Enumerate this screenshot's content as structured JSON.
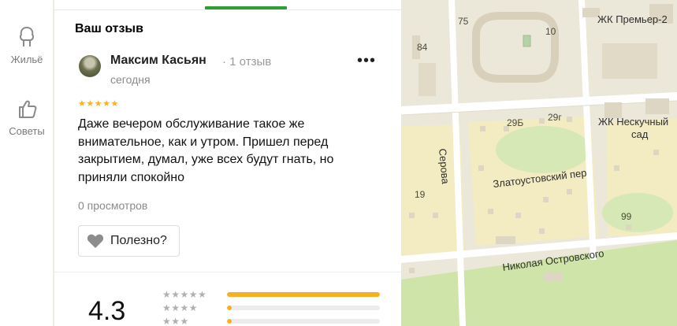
{
  "rail": {
    "items": [
      {
        "label": "Жильё",
        "icon": "housing-icon"
      },
      {
        "label": "Советы",
        "icon": "thumbs-up-icon"
      }
    ]
  },
  "panel": {
    "section_title": "Ваш отзыв",
    "review": {
      "author": "Максим Касьян",
      "reviews_count": "1 отзыв",
      "date": "сегодня",
      "rating_stars": "★★★★★",
      "rating": 5,
      "text": "Даже вечером обслуживание такое же внимательное, как и утром. Пришел перед закрытием, думал, уже всех будут гнать, но приняли спокойно",
      "views": "0 просмотров",
      "useful_label": "Полезно?"
    },
    "summary": {
      "rating": "4.3",
      "distribution": [
        {
          "stars": "★★★★★",
          "fraction": 1.0
        },
        {
          "stars": "★★★★",
          "fraction": 0.03
        },
        {
          "stars": "★★★",
          "fraction": 0.03
        }
      ]
    },
    "accent_color": "#2e9e34",
    "star_color": "#f7b020"
  },
  "map": {
    "labels": {
      "b75": "75",
      "b10": "10",
      "b84": "84",
      "premier": "ЖК Премьер-2",
      "b29b": "29Б",
      "b29g": "29г",
      "neskuchny1": "ЖК Нескучный",
      "neskuchny2": "сад",
      "serova": "Серова",
      "zlatoust": "Златоустовский пер",
      "b19": "19",
      "b99": "99",
      "ostrovsky": "Николая Островского"
    }
  }
}
